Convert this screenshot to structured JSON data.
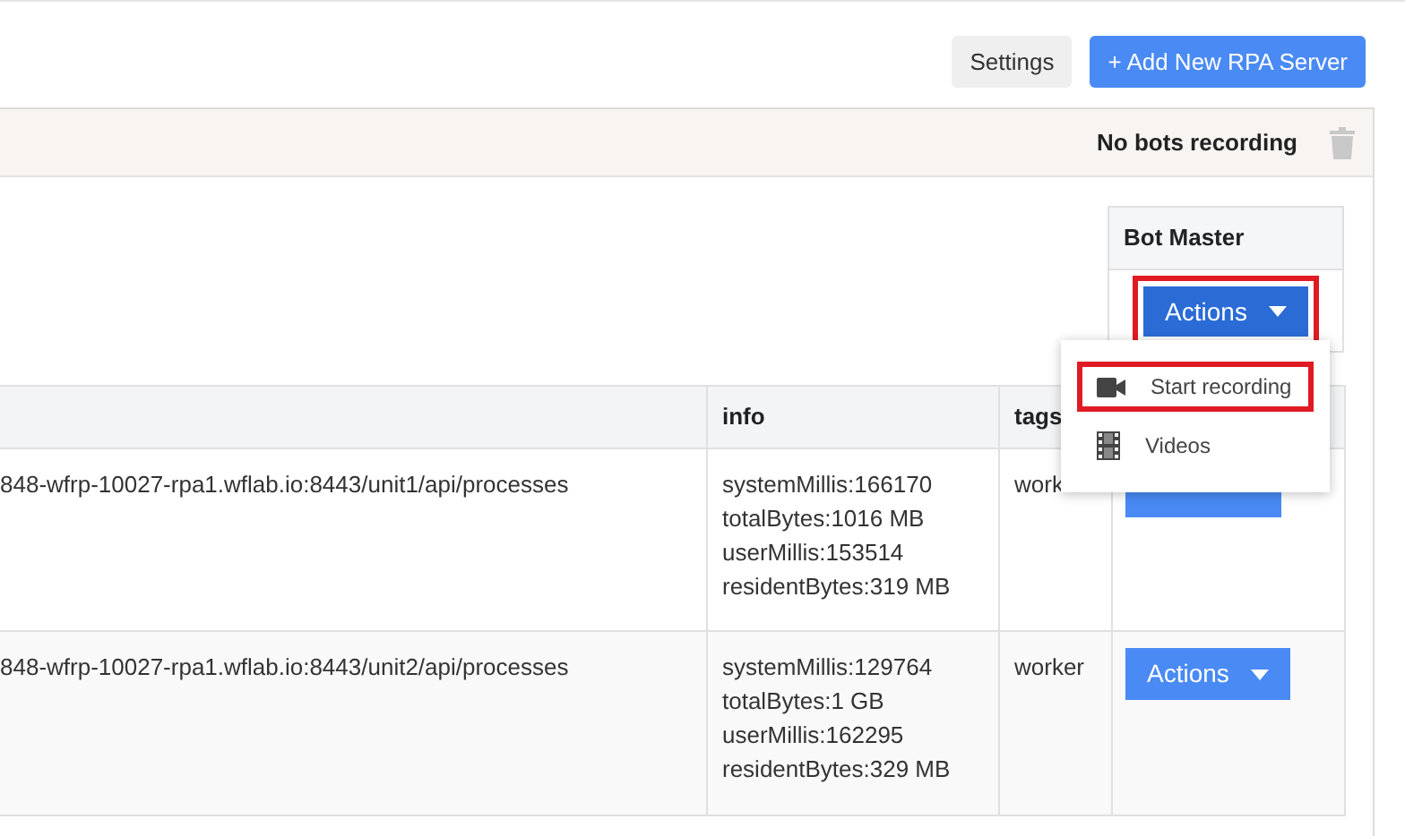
{
  "toolbar": {
    "buttons": [
      {
        "label": "Settings",
        "kind": "secondary"
      },
      {
        "label": "+ Add New RPA Server",
        "kind": "primary"
      }
    ]
  },
  "panel": {
    "status": "No bots recording"
  },
  "bot_master": {
    "heading": "Bot Master",
    "action": {
      "label": "Actions",
      "highlighted": true
    }
  },
  "menu": {
    "items": [
      {
        "label": "Start recording",
        "kind": "camera",
        "highlighted": true
      },
      {
        "label": "Videos",
        "kind": "film",
        "highlighted": false
      }
    ]
  },
  "table": {
    "columns": [
      "info",
      "tags"
    ],
    "rows": [
      {
        "url": "848-wfrp-10027-rpa1.wflab.io:8443/unit1/api/processes",
        "info": [
          "systemMillis:166170",
          "totalBytes:1016 MB",
          "userMillis:153514",
          "residentBytes:319 MB"
        ],
        "tags": "work"
      },
      {
        "url": "848-wfrp-10027-rpa1.wflab.io:8443/unit2/api/processes",
        "info": [
          "systemMillis:129764",
          "totalBytes:1 GB",
          "userMillis:162295",
          "residentBytes:329 MB"
        ],
        "tags": "worker",
        "action": "Actions"
      }
    ]
  }
}
